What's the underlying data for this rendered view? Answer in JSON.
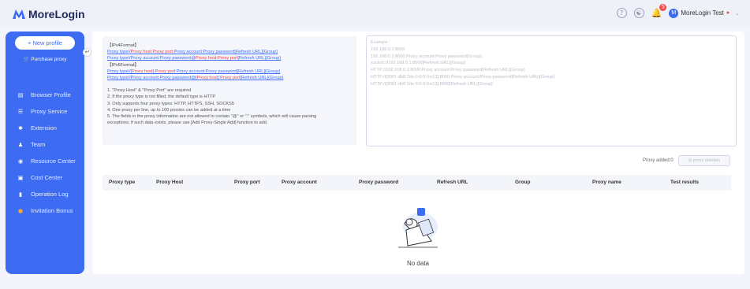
{
  "app": {
    "name": "MoreLogin"
  },
  "header": {
    "notification_count": "5",
    "user_name": "MoreLogin Test",
    "avatar_letter": "M"
  },
  "sidebar": {
    "new_profile": "+ New profile",
    "purchase_proxy": "Purchase proxy",
    "items": [
      {
        "label": "Browser Profile",
        "icon": "window-icon"
      },
      {
        "label": "Proxy Service",
        "icon": "server-icon"
      },
      {
        "label": "Extension",
        "icon": "puzzle-icon"
      },
      {
        "label": "Team",
        "icon": "users-icon"
      },
      {
        "label": "Resource Center",
        "icon": "pin-icon"
      },
      {
        "label": "Cost Center",
        "icon": "card-icon"
      },
      {
        "label": "Operation Log",
        "icon": "doc-icon"
      },
      {
        "label": "Invitation Bonus",
        "icon": "coin-icon"
      }
    ]
  },
  "format_box": {
    "ipv4_title": "【IPv4Format】",
    "ipv4_line1": {
      "a": "Proxy type//",
      "b": "Proxy host",
      "c": ":",
      "d": "Proxy port",
      "e": ":Proxy account:Proxy password[Refresh URL]{Group}"
    },
    "ipv4_line2": {
      "a": "Proxy type//Proxy account:Proxy password@",
      "b": "Proxy host:Proxy port",
      "c": "[Refresh URL]{Group}"
    },
    "ipv6_title": "【IPv6Format】",
    "ipv6_line1": {
      "a": "Proxy type//[",
      "b": "Proxy host",
      "c": "]:",
      "d": "Proxy port",
      "e": ":Proxy account:Proxy password[Refresh URL]{Group}"
    },
    "ipv6_line2": {
      "a": "Proxy type//Proxy account:Proxy password@[",
      "b": "Proxy host",
      "c": "]:",
      "d": "Proxy port",
      "e": "[Refresh URL]{Group}"
    },
    "rules": [
      "1. \"Proxy Host\" & \"Proxy Port\" are required",
      "2. If the proxy type is not filled, the default type is HTTP",
      "3. Only supports four proxy types: HTTP, HTTPS, SSH, SOCKS5",
      "4. One proxy per line, up to 100 proxies can be added at a time",
      "5. The fields in the proxy information are not allowed to contain \"@\" or \":\" symbols, which will cause parsing",
      "exceptions; if such data exists, please use [Add Proxy-Single Add] function to add."
    ]
  },
  "example_placeholder": [
    "Example :",
    "192.168.0.1:8000",
    "192.168.0.1:8000:Proxy account:Proxy password{Group}",
    "socks5://192.168.0.1:8000[Refresh URL]{Group}",
    "HTTP://192.168.0.1:8000:Proxy account:Proxy password[Refresh URL]{Group}",
    "HTTP://[2001:db8:2de:0:0:0:0:e13]:8000:Proxy account:Proxy password[Refresh URL]{Group}",
    "HTTP://[2001:db8:2de:0:0:0:0:e13]:8000[Refresh URL]{Group}"
  ],
  "proxy_added_label": "Proxy added:0",
  "delete_button": "⊘ proxy deletion",
  "table": {
    "columns": [
      "Proxy type",
      "Proxy Host",
      "Proxy port",
      "Proxy account",
      "Proxy password",
      "Refresh URL",
      "Group",
      "Proxy name",
      "Test results"
    ]
  },
  "empty_state": "No data"
}
